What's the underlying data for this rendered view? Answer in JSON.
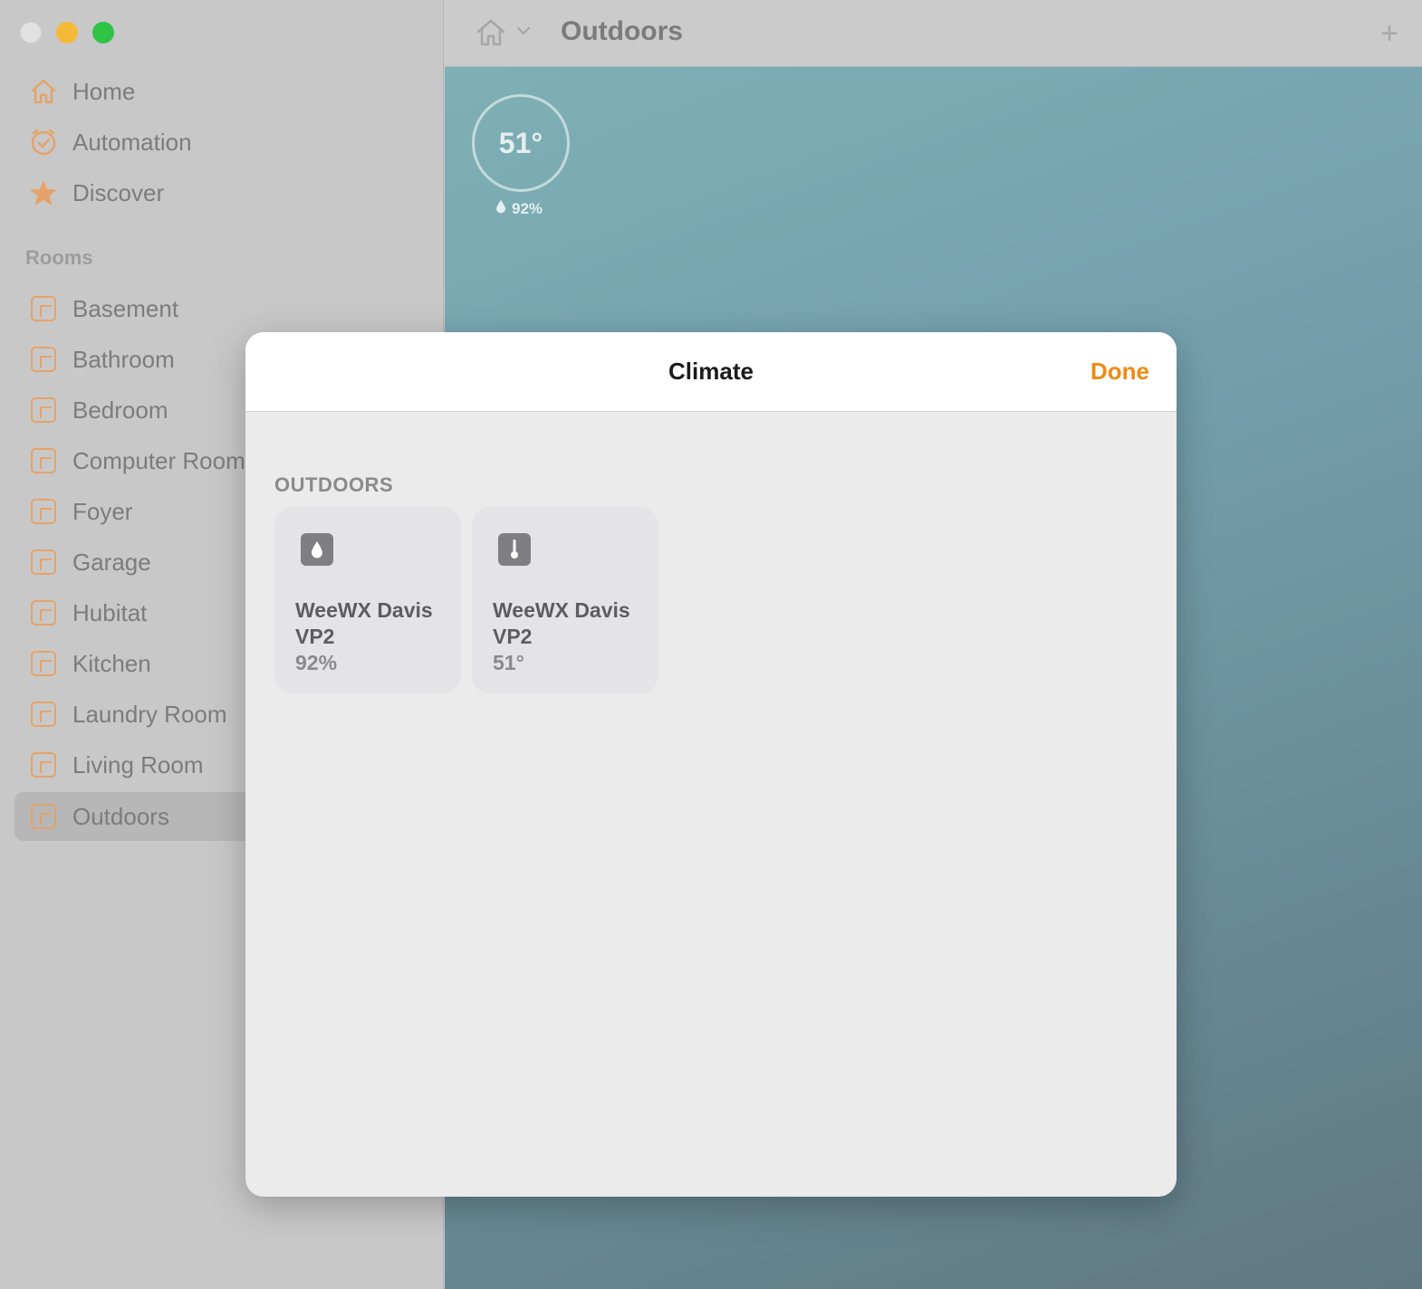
{
  "window": {
    "controls": [
      "close",
      "minimize",
      "maximize"
    ]
  },
  "sidebar": {
    "nav": [
      {
        "label": "Home",
        "icon": "house-icon"
      },
      {
        "label": "Automation",
        "icon": "clock-check-icon"
      },
      {
        "label": "Discover",
        "icon": "star-icon"
      }
    ],
    "rooms_heading": "Rooms",
    "rooms": [
      {
        "label": "Basement"
      },
      {
        "label": "Bathroom"
      },
      {
        "label": "Bedroom"
      },
      {
        "label": "Computer Room"
      },
      {
        "label": "Foyer"
      },
      {
        "label": "Garage"
      },
      {
        "label": "Hubitat"
      },
      {
        "label": "Kitchen"
      },
      {
        "label": "Laundry Room"
      },
      {
        "label": "Living Room"
      },
      {
        "label": "Outdoors",
        "selected": true
      }
    ],
    "accent_color": "#e4a36a"
  },
  "toolbar": {
    "title": "Outdoors",
    "add_label": "+"
  },
  "status": {
    "temperature": "51°",
    "humidity": "92%"
  },
  "modal": {
    "title": "Climate",
    "done_label": "Done",
    "done_color": "#f08a13",
    "section_title": "OUTDOORS",
    "tiles": [
      {
        "name": "WeeWX Davis VP2",
        "value": "92%",
        "icon": "humidity-drop-icon"
      },
      {
        "name": "WeeWX Davis VP2",
        "value": "51°",
        "icon": "thermometer-icon"
      }
    ]
  }
}
